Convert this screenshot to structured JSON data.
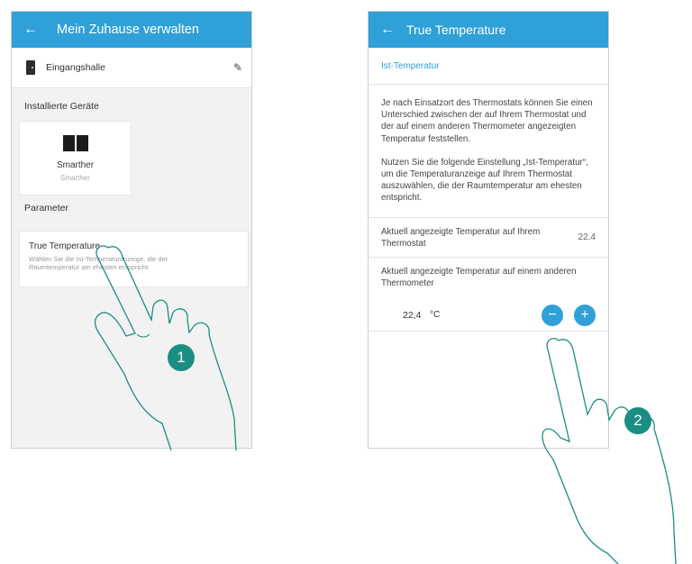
{
  "screen1": {
    "appbar": {
      "back_icon": "arrow-left-icon",
      "title": "Mein Zuhause verwalten"
    },
    "room": {
      "icon": "door-icon",
      "name": "Eingangshalle",
      "edit_icon": "pencil-icon"
    },
    "installed_title": "Installierte Geräte",
    "device": {
      "icon": "smarther-thermostat-icon",
      "name": "Smarther",
      "subtitle": "Smarther"
    },
    "parameter_title": "Parameter",
    "parameter_card": {
      "title": "True Temperature",
      "description_line1": "Wählen Sie die Ist-Temperaturanzeige, die der",
      "description_line2": "Raumtemperatur am ehesten entspricht"
    },
    "step_badge": "1"
  },
  "screen2": {
    "appbar": {
      "back_icon": "arrow-left-icon",
      "title": "True Temperature"
    },
    "subheader": "Ist-Temperatur",
    "paragraph1": "Je nach Einsatzort des Thermostats können Sie einen Unterschied zwischen der auf Ihrem Thermostat und der auf einem anderen Thermometer angezeigten Temperatur feststellen.",
    "paragraph2": "Nutzen Sie die folgende Einstellung „Ist-Temperatur“, um die Temperaturanzeige auf Ihrem Thermostat auszuwählen, die der Raumtemperatur am ehesten entspricht.",
    "current_label": "Aktuell angezeigte Temperatur auf Ihrem Thermostat",
    "current_value": "22.4",
    "other_label": "Aktuell angezeigte Temperatur auf einem anderen Thermometer",
    "stepper": {
      "value": "22,4",
      "unit": "°C",
      "minus": "−",
      "plus": "+"
    },
    "step_badge": "2"
  },
  "colors": {
    "accent": "#2fa0d8",
    "badge": "#1b8e83"
  }
}
